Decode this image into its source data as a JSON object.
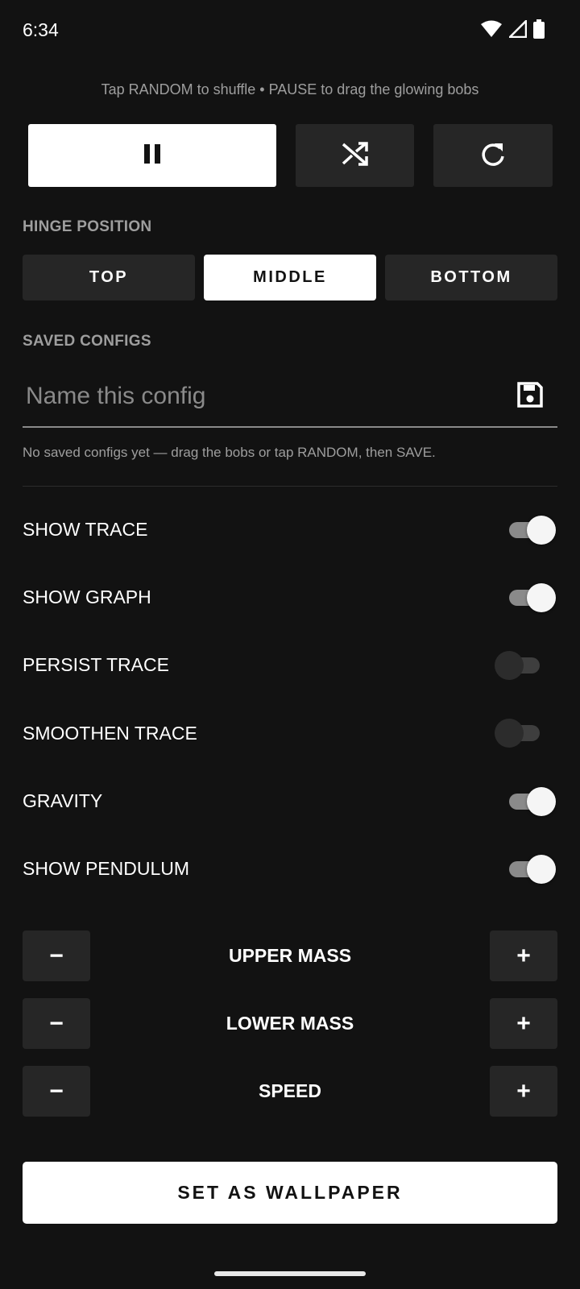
{
  "status_bar": {
    "time": "6:34",
    "icons": [
      "wifi-icon",
      "signal-icon",
      "battery-icon"
    ]
  },
  "hint": "Tap RANDOM to shuffle • PAUSE to drag the glowing bobs",
  "controls": {
    "pause_icon": "pause-icon",
    "random_icon": "shuffle-icon",
    "reset_icon": "refresh-icon"
  },
  "hinge": {
    "label": "HINGE POSITION",
    "options": [
      "TOP",
      "MIDDLE",
      "BOTTOM"
    ],
    "selected": "MIDDLE"
  },
  "saved_configs": {
    "label": "SAVED CONFIGS",
    "placeholder": "Name this config",
    "value": "",
    "save_icon": "save-icon",
    "empty_message": "No saved configs yet — drag the bobs or tap RANDOM, then SAVE."
  },
  "toggles": [
    {
      "label": "SHOW TRACE",
      "on": true
    },
    {
      "label": "SHOW GRAPH",
      "on": true
    },
    {
      "label": "PERSIST TRACE",
      "on": false
    },
    {
      "label": "SMOOTHEN TRACE",
      "on": false
    },
    {
      "label": "GRAVITY",
      "on": true
    },
    {
      "label": "SHOW PENDULUM",
      "on": true
    }
  ],
  "steppers": [
    {
      "label": "UPPER MASS",
      "minus": "−",
      "plus": "+"
    },
    {
      "label": "LOWER MASS",
      "minus": "−",
      "plus": "+"
    },
    {
      "label": "SPEED",
      "minus": "−",
      "plus": "+"
    }
  ],
  "wallpaper_button": "SET AS WALLPAPER",
  "colors": {
    "background": "#121212",
    "surface": "#262626",
    "accent": "#ffffff",
    "muted": "#9e9e9e"
  }
}
